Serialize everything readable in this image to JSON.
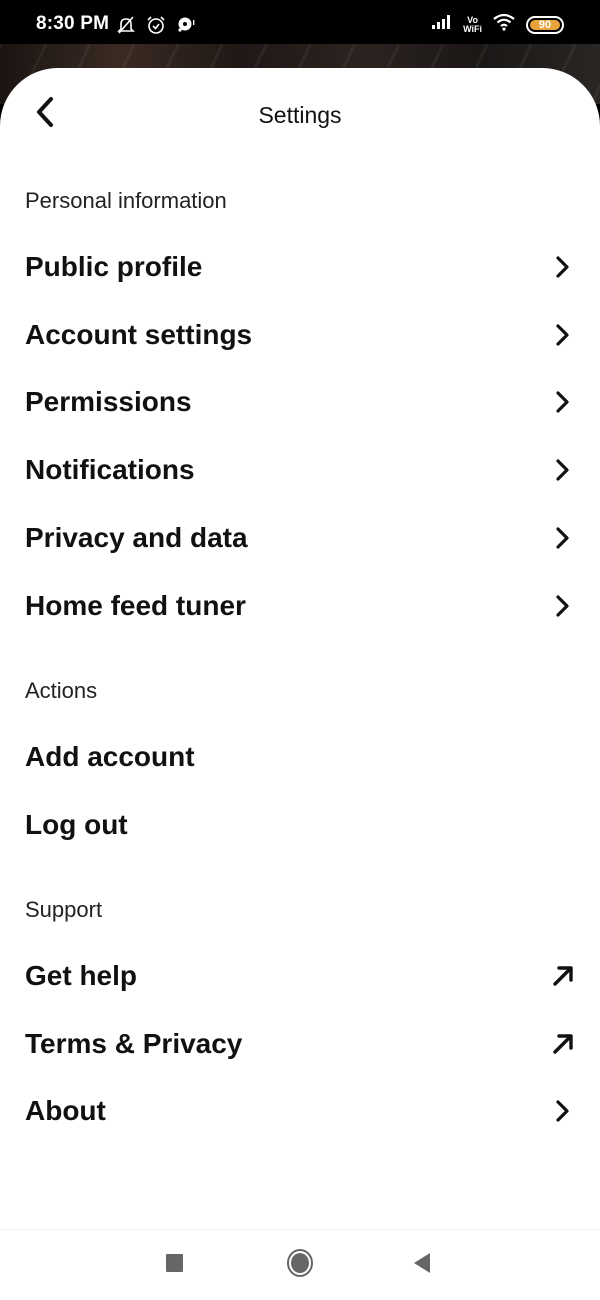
{
  "status_bar": {
    "time": "8:30 PM",
    "left_icons": [
      "notifications-muted-icon",
      "alarm-icon",
      "app-notification-icon"
    ],
    "right_icons": [
      "signal-icon",
      "vowifi-icon",
      "wifi-icon",
      "battery-icon"
    ],
    "vowifi_top": "Vo",
    "vowifi_bottom": "WiFi",
    "battery_level": "90",
    "battery_color": "#e8a23a"
  },
  "header": {
    "title": "Settings",
    "back_icon": "chevron-left-icon"
  },
  "sections": [
    {
      "label": "Personal information",
      "items": [
        {
          "label": "Public profile",
          "icon": "chevron-right-icon"
        },
        {
          "label": "Account settings",
          "icon": "chevron-right-icon"
        },
        {
          "label": "Permissions",
          "icon": "chevron-right-icon"
        },
        {
          "label": "Notifications",
          "icon": "chevron-right-icon"
        },
        {
          "label": "Privacy and data",
          "icon": "chevron-right-icon"
        },
        {
          "label": "Home feed tuner",
          "icon": "chevron-right-icon"
        }
      ]
    },
    {
      "label": "Actions",
      "items": [
        {
          "label": "Add account"
        },
        {
          "label": "Log out"
        }
      ]
    },
    {
      "label": "Support",
      "items": [
        {
          "label": "Get help",
          "icon": "external-link-arrow-icon"
        },
        {
          "label": "Terms & Privacy",
          "icon": "external-link-arrow-icon"
        },
        {
          "label": "About",
          "icon": "chevron-right-icon"
        }
      ]
    }
  ],
  "nav_bar": {
    "buttons": [
      "recents-square-icon",
      "home-circle-icon",
      "back-triangle-icon"
    ],
    "color": "#666666"
  }
}
